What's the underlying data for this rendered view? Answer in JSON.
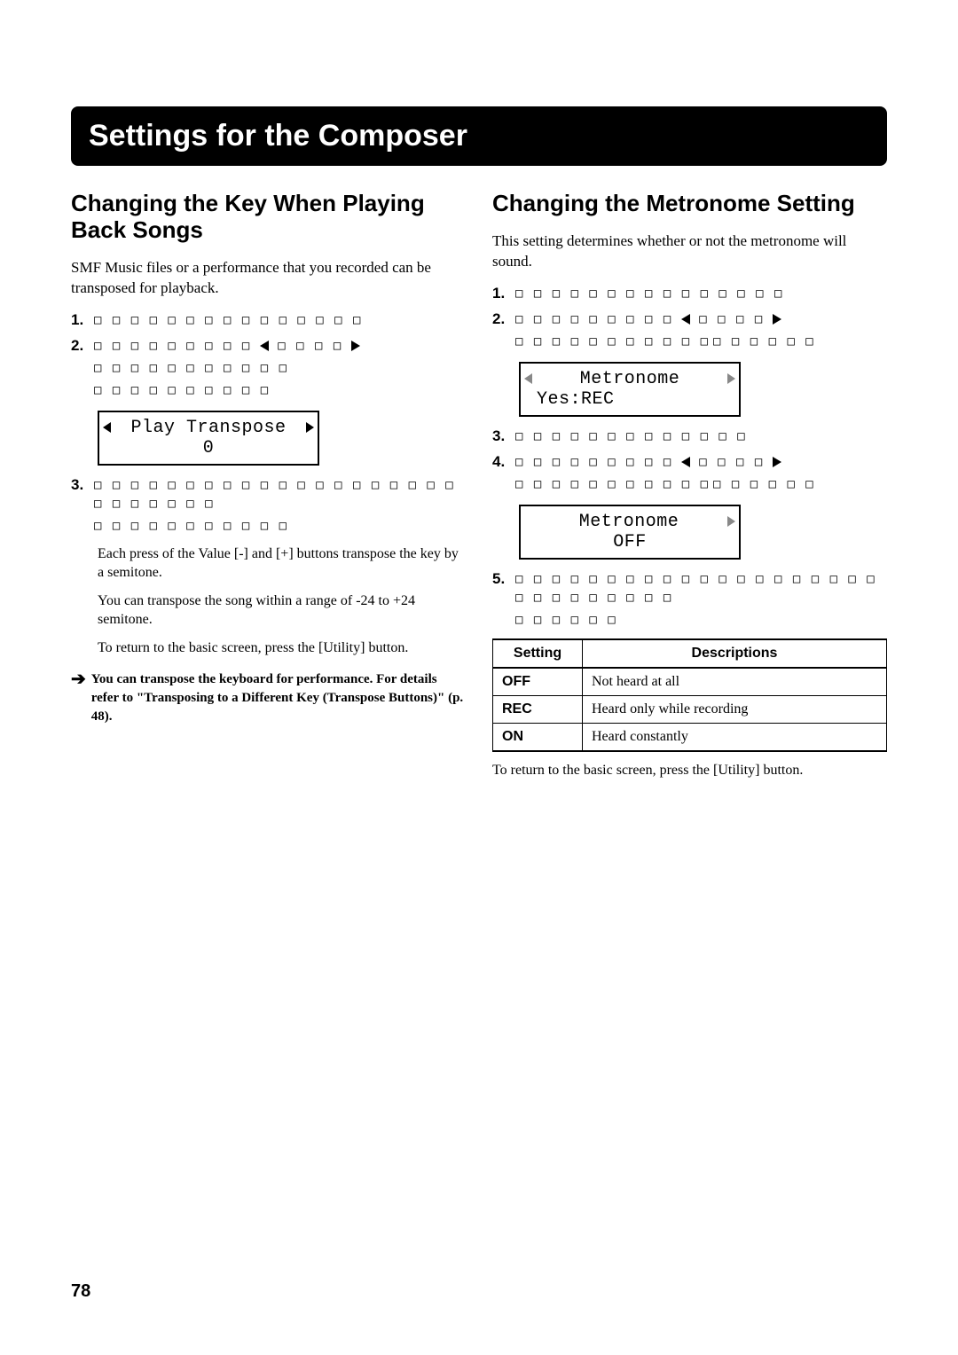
{
  "page_title": "Settings for the Composer",
  "page_number": "78",
  "left": {
    "heading": "Changing the Key When Playing Back Songs",
    "intro": "SMF Music files or a performance that you recorded can be transposed for playback.",
    "steps": {
      "s1": {
        "num": "1.",
        "ph": "□ □ □ □ □ □ □ □ □ □ □ □ □ □ □"
      },
      "s2": {
        "num": "2.",
        "ph_a": "□ □ □ □ □ □ □ □ □",
        "ph_b": "□ □ □ □",
        "ph_c": "□ □ □ □ □ □ □ □ □ □ □",
        "ph_d": "□ □ □ □ □ □ □ □ □ □"
      },
      "s3": {
        "num": "3.",
        "ph_a": "□ □ □ □ □ □ □ □ □ □ □ □ □ □ □ □ □ □ □ □ □ □ □ □ □ □ □",
        "ph_b": "□ □ □ □ □ □ □ □ □ □ □"
      }
    },
    "lcd1": {
      "line1": "Play Transpose",
      "line2": "0"
    },
    "notes": {
      "n1": "Each press of the Value [-] and [+] buttons transpose the key by a semitone.",
      "n2": "You can transpose the song within a range of -24 to +24 semitone.",
      "n3": "To return to the basic screen, press the [Utility] button."
    },
    "footnote": "You can transpose the keyboard for performance. For details refer to \"Transposing to a Different Key (Transpose Buttons)\" (p. 48)."
  },
  "right": {
    "heading": "Changing the Metronome Setting",
    "intro": "This setting determines whether or not the metronome will sound.",
    "steps": {
      "s1": {
        "num": "1.",
        "ph": "□ □ □ □ □ □ □ □ □ □ □ □ □ □ □"
      },
      "s2": {
        "num": "2.",
        "ph_a": "□ □ □ □ □ □ □ □ □",
        "ph_b": "□ □ □ □",
        "ph_c": "□ □ □ □ □ □ □ □ □ □ □",
        "ph_d": "□ □ □ □ □ □"
      },
      "s3": {
        "num": "3.",
        "ph": "□ □ □ □ □ □ □ □ □ □ □ □ □"
      },
      "s4": {
        "num": "4.",
        "ph_a": "□ □ □ □ □ □ □ □ □",
        "ph_b": "□ □ □ □",
        "ph_c": "□ □ □ □ □ □ □ □ □ □ □",
        "ph_d": "□ □ □ □ □ □"
      },
      "s5": {
        "num": "5.",
        "ph_a": "□ □ □ □ □ □ □ □ □ □ □ □ □ □ □ □ □ □ □ □ □ □ □ □ □ □ □ □ □",
        "ph_b": "□ □ □ □ □ □"
      }
    },
    "lcd1": {
      "line1": "Metronome",
      "line2": "Yes:REC"
    },
    "lcd2": {
      "line1": "Metronome",
      "line2": "OFF"
    },
    "table": {
      "header": {
        "c1": "Setting",
        "c2": "Descriptions"
      },
      "rows": [
        {
          "k": "OFF",
          "v": "Not heard at all"
        },
        {
          "k": "REC",
          "v": "Heard only while recording"
        },
        {
          "k": "ON",
          "v": "Heard constantly"
        }
      ]
    },
    "return_note": "To return to the basic screen, press the [Utility] button."
  }
}
